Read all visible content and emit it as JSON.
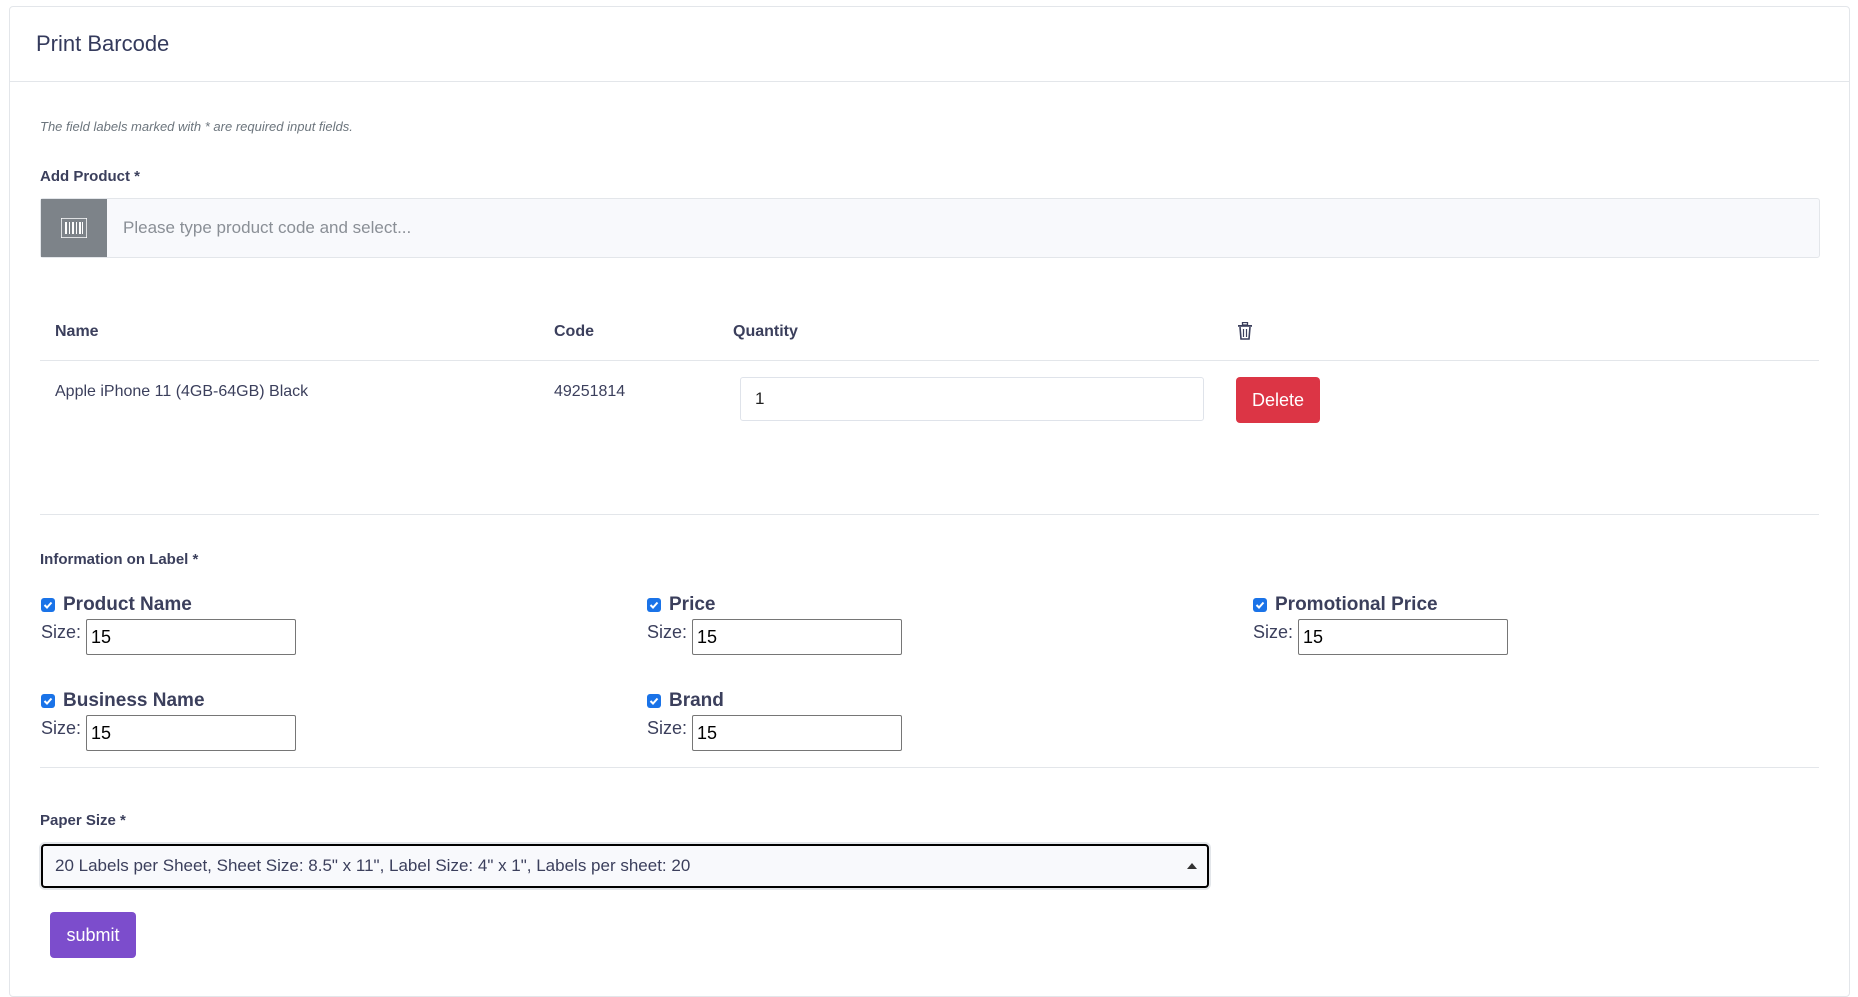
{
  "header": {
    "title": "Print Barcode"
  },
  "form": {
    "required_note": "The field labels marked with * are required input fields.",
    "add_product_label": "Add Product *",
    "search_placeholder": "Please type product code and select..."
  },
  "table": {
    "columns": [
      "Name",
      "Code",
      "Quantity"
    ],
    "rows": [
      {
        "name": "Apple iPhone 11 (4GB-64GB) Black",
        "code": "49251814",
        "quantity": "1",
        "delete_label": "Delete"
      }
    ]
  },
  "label_info": {
    "title": "Information on Label *",
    "size_label": "Size:",
    "options": [
      {
        "name": "Product Name",
        "checked": true,
        "size": "15"
      },
      {
        "name": "Price",
        "checked": true,
        "size": "15"
      },
      {
        "name": "Promotional Price",
        "checked": true,
        "size": "15"
      },
      {
        "name": "Business Name",
        "checked": true,
        "size": "15"
      },
      {
        "name": "Brand",
        "checked": true,
        "size": "15"
      }
    ]
  },
  "paper": {
    "label": "Paper Size *",
    "selected": "20 Labels per Sheet, Sheet Size: 8.5\" x 11\", Label Size: 4\" x 1\", Labels per sheet: 20"
  },
  "actions": {
    "submit_label": "submit"
  },
  "colors": {
    "delete": "#dc3545",
    "submit": "#7c4dcc",
    "checkbox": "#1a73e8"
  }
}
